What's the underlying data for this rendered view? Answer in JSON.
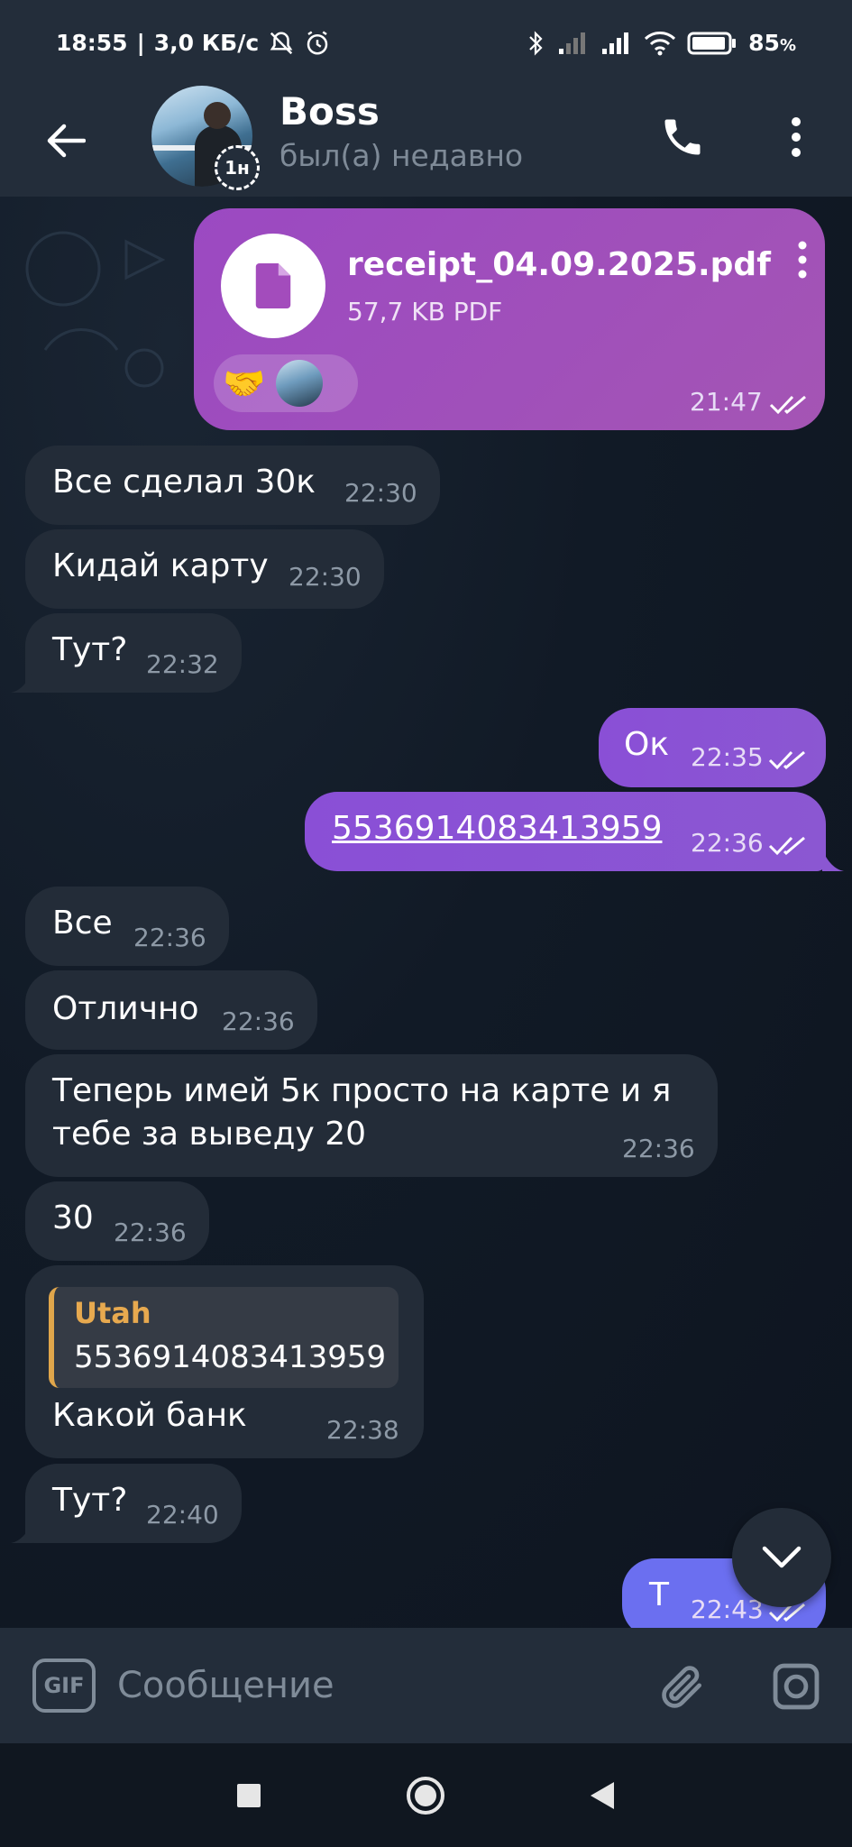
{
  "status_bar": {
    "time": "18:55",
    "net_speed": "3,0 КБ/с",
    "battery": "85",
    "battery_unit": "%"
  },
  "header": {
    "title": "Boss",
    "subtitle": "был(а) недавно",
    "story_badge": "1н"
  },
  "messages": [
    {
      "id": "m1",
      "dir": "out",
      "type": "file",
      "file_name": "receipt_04.09.2025.pdf",
      "file_meta": "57,7 KB PDF",
      "reaction_emoji": "🤝",
      "time": "21:47",
      "read": true
    },
    {
      "id": "m2",
      "dir": "in",
      "text": "Все сделал 30к",
      "time": "22:30"
    },
    {
      "id": "m3",
      "dir": "in",
      "text": "Кидай карту",
      "time": "22:30"
    },
    {
      "id": "m4",
      "dir": "in",
      "text": "Тут?",
      "time": "22:32"
    },
    {
      "id": "m5",
      "dir": "out",
      "text": "Ок",
      "time": "22:35",
      "read": true
    },
    {
      "id": "m6",
      "dir": "out",
      "text": "5536914083413959",
      "time": "22:36",
      "read": true,
      "link": true
    },
    {
      "id": "m7",
      "dir": "in",
      "text": "Все",
      "time": "22:36"
    },
    {
      "id": "m8",
      "dir": "in",
      "text": "Отлично",
      "time": "22:36"
    },
    {
      "id": "m9",
      "dir": "in",
      "text_line1": "Теперь имей 5к просто на карте и я",
      "text_line2": "тебе за выведу 20",
      "time": "22:36"
    },
    {
      "id": "m10",
      "dir": "in",
      "text": "30",
      "time": "22:36"
    },
    {
      "id": "m11",
      "dir": "in",
      "quote_name": "Utah",
      "quote_text": "5536914083413959",
      "text": "Какой банк",
      "time": "22:38"
    },
    {
      "id": "m12",
      "dir": "in",
      "text": "Тут?",
      "time": "22:40"
    },
    {
      "id": "m13",
      "dir": "out",
      "text": "Т",
      "time": "22:43",
      "read": true
    }
  ],
  "input": {
    "gif_label": "GIF",
    "placeholder": "Сообщение"
  },
  "colors": {
    "header_bg": "#232d3a",
    "incoming_bubble": "#232c38",
    "outgoing_bubble": "#8a4fd6",
    "file_bubble": "#a04fbd",
    "quote_accent": "#e0a64b"
  }
}
